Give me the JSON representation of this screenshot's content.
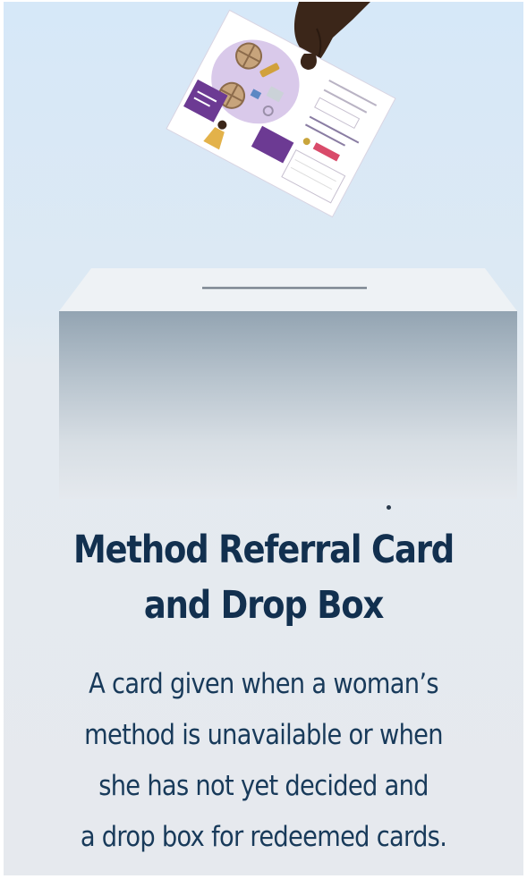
{
  "heading": {
    "line1": "Method Referral Card",
    "line2": "and Drop Box"
  },
  "description": {
    "lines": [
      "A card given when a woman’s",
      "method is unavailable or when",
      "she has not yet decided and",
      "a drop box for redeemed cards."
    ]
  },
  "colors": {
    "heading": "#12304f",
    "body_text": "#183a5a",
    "card_purple": "#6c3a93",
    "skin": "#3b2619"
  },
  "illustration": {
    "subject": "hand-dropping-referral-card-into-box",
    "icons": [
      "referral-card-icon",
      "hand-icon",
      "drop-box-icon"
    ]
  }
}
